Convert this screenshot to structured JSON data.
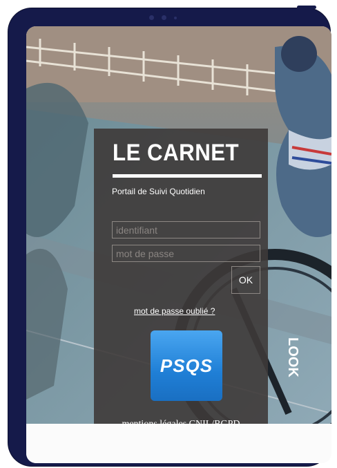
{
  "login": {
    "title": "LE CARNET",
    "subtitle": "Portail de Suivi Quotidien",
    "username_placeholder": "identifiant",
    "password_placeholder": "mot de passe",
    "ok_label": "OK",
    "forgot_link": "mot de passe oublié ?",
    "logo_text": "PSQS",
    "legal_link": "mentions légales CNIL/RGPD"
  },
  "colors": {
    "device_frame": "#151a4a",
    "panel_overlay": "#3e3a38",
    "logo_blue": "#2a8ae0"
  }
}
